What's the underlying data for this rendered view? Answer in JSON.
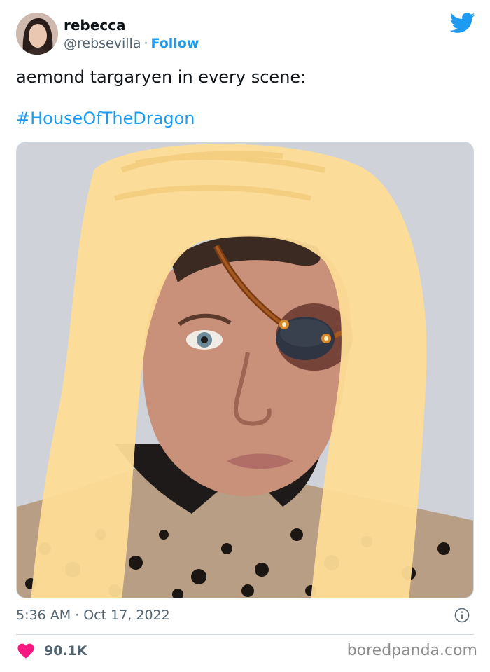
{
  "author": {
    "name": "rebecca",
    "handle": "@rebsevilla",
    "separator": "·",
    "follow_label": "Follow"
  },
  "tweet": {
    "text": "aemond targaryen in every scene:",
    "hashtag": "#HouseOfTheDragon"
  },
  "meta": {
    "timestamp": "5:36 AM · Oct 17, 2022",
    "likes": "90.1K"
  },
  "watermark": "boredpanda.com",
  "icons": {
    "logo": "twitter-bird-icon",
    "info": "info-icon",
    "like": "heart-icon"
  },
  "colors": {
    "accent": "#1d9bf0",
    "like": "#f91880",
    "muted": "#536471"
  }
}
